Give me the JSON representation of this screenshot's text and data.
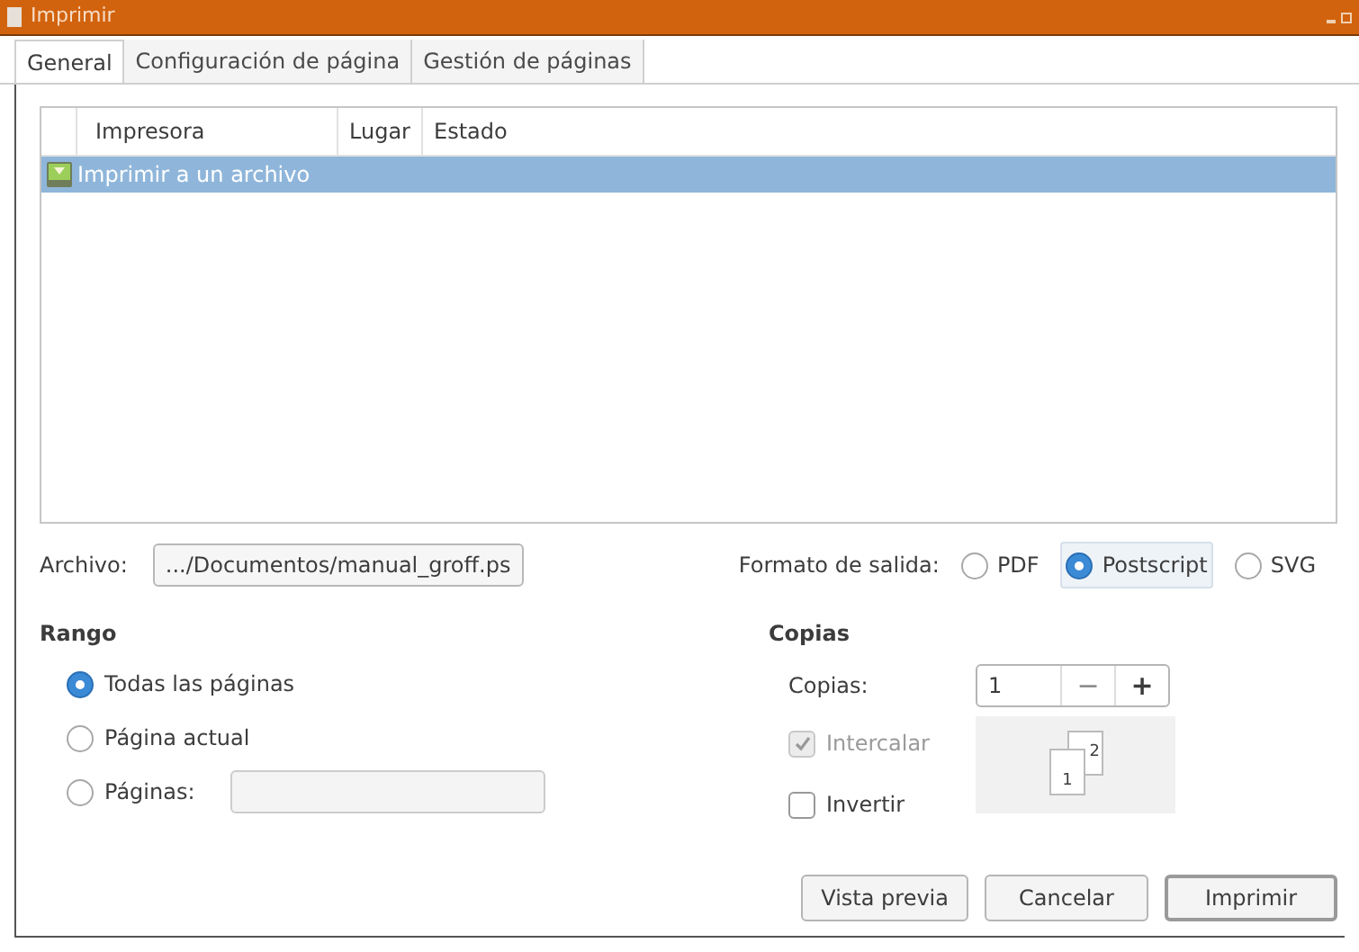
{
  "window": {
    "title": "Imprimir"
  },
  "tabs": [
    {
      "label": "General",
      "selected": true
    },
    {
      "label": "Configuración de página",
      "selected": false
    },
    {
      "label": "Gestión de páginas",
      "selected": false
    }
  ],
  "printers": {
    "columns": [
      "Impresora",
      "Lugar",
      "Estado"
    ],
    "rows": [
      {
        "name": "Imprimir a un archivo",
        "selected": true
      }
    ]
  },
  "file": {
    "label": "Archivo:",
    "value": ".../Documentos/manual_groff.ps"
  },
  "output_format": {
    "label": "Formato de salida:",
    "options": [
      {
        "label": "PDF",
        "selected": false
      },
      {
        "label": "Postscript",
        "selected": true
      },
      {
        "label": "SVG",
        "selected": false
      }
    ]
  },
  "range": {
    "title": "Rango",
    "options": [
      {
        "label": "Todas las páginas",
        "selected": true,
        "kind": "plain"
      },
      {
        "label": "Página actual",
        "selected": false,
        "kind": "plain"
      },
      {
        "label": "Páginas:",
        "selected": false,
        "kind": "field"
      }
    ]
  },
  "copies": {
    "title": "Copias",
    "label": "Copias:",
    "value": "1",
    "minus": "−",
    "plus": "+",
    "collate": {
      "label": "Intercalar",
      "checked": true,
      "disabled": true
    },
    "reverse": {
      "label": "Invertir",
      "checked": false,
      "disabled": false
    },
    "preview_pages": [
      "1",
      "2"
    ]
  },
  "buttons": [
    {
      "label": "Vista previa",
      "default": false
    },
    {
      "label": "Cancelar",
      "default": false
    },
    {
      "label": "Imprimir",
      "default": true
    }
  ]
}
